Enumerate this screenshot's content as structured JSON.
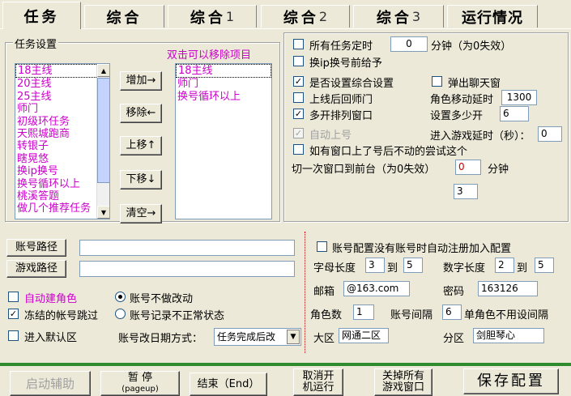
{
  "tabs": [
    {
      "label": "任务",
      "num": ""
    },
    {
      "label": "综合",
      "num": ""
    },
    {
      "label": "综合",
      "num": "1"
    },
    {
      "label": "综合",
      "num": "2"
    },
    {
      "label": "综合",
      "num": "3"
    },
    {
      "label": "运行情况",
      "num": ""
    }
  ],
  "task_settings": {
    "group_label": "任务设置",
    "hint": "双击可以移除项目",
    "available": [
      "18主线",
      "20主线",
      "25主线",
      "师门",
      "初级环任务",
      "天熙城跑商",
      "转银子",
      "瞎晃悠",
      "换ip换号",
      "换号循环以上",
      "桃溪答题",
      "做几个推荐任务"
    ],
    "selected": [
      "18主线",
      "师门",
      "换号循环以上"
    ],
    "buttons": {
      "add": "增加→",
      "remove": "移除←",
      "up": "上移↑",
      "down": "下移↓",
      "clear": "清空→"
    }
  },
  "options": {
    "all_task_timer": {
      "label": "所有任务定时",
      "value": "0",
      "unit": "分钟（为0失效）",
      "checked": false
    },
    "give_before_switch": {
      "label": "换ip换号前给予",
      "checked": false
    },
    "use_general": {
      "label": "是否设置综合设置",
      "checked": true
    },
    "popup_chat": {
      "label": "弹出聊天窗",
      "checked": false
    },
    "return_master": {
      "label": "上线后回师门",
      "checked": false
    },
    "move_delay_label": "角色移动延时",
    "move_delay": "1300",
    "multi_window": {
      "label": "多开排列窗口",
      "checked": true
    },
    "multi_count_label": "设置多少开",
    "multi_count": "6",
    "auto_online": {
      "label": "自动上号",
      "checked": true,
      "disabled": true
    },
    "game_delay_label": "进入游戏延时（秒）：",
    "game_delay": "0",
    "retry_window": {
      "label": "如有窗口上了号后不动的尝试这个",
      "checked": false
    },
    "front_switch_label": "切一次窗口到前台（为0失效）",
    "front_switch_value": "0",
    "front_switch_unit": "分钟",
    "extra_value": "3"
  },
  "account": {
    "account_path_btn": "账号路径",
    "account_path_value": "",
    "game_path_btn": "游戏路径",
    "game_path_value": "",
    "auto_create": {
      "label": "自动建角色",
      "checked": false
    },
    "no_change": {
      "label": "账号不做改动",
      "selected": true
    },
    "skip_frozen": {
      "label": "冻结的帐号跳过",
      "checked": true
    },
    "log_abnormal": {
      "label": "账号记录不正常状态",
      "selected": false
    },
    "enter_default": {
      "label": "进入默认区",
      "checked": false
    },
    "date_method_label": "账号改日期方式：",
    "date_method_value": "任务完成后改"
  },
  "register": {
    "auto_register": {
      "label": "账号配置没有账号时自动注册加入配置",
      "checked": false
    },
    "letter_len_label": "字母长度",
    "letter_min": "3",
    "to1": "到",
    "letter_max": "5",
    "digit_len_label": "数字长度",
    "digit_min": "2",
    "to2": "到",
    "digit_max": "5",
    "email_label": "邮箱",
    "email_value": "@163.com",
    "password_label": "密码",
    "password_value": "163126",
    "role_count_label": "角色数",
    "role_count": "1",
    "account_gap_label": "账号间隔",
    "account_gap": "6",
    "single_role_label": "单角色不用设间隔",
    "region_label": "大区",
    "region_value": "网通二区",
    "server_label": "分区",
    "server_value": "剑胆琴心"
  },
  "bottom": {
    "start": "启动辅助",
    "pause": "暂 停",
    "pause_sub": "(pageup)",
    "end": "结束（End）",
    "cancel_line1": "取消开",
    "cancel_line2": "机运行",
    "close_all_line1": "关掉所有",
    "close_all_line2": "游戏窗口",
    "save": "保存配置"
  }
}
